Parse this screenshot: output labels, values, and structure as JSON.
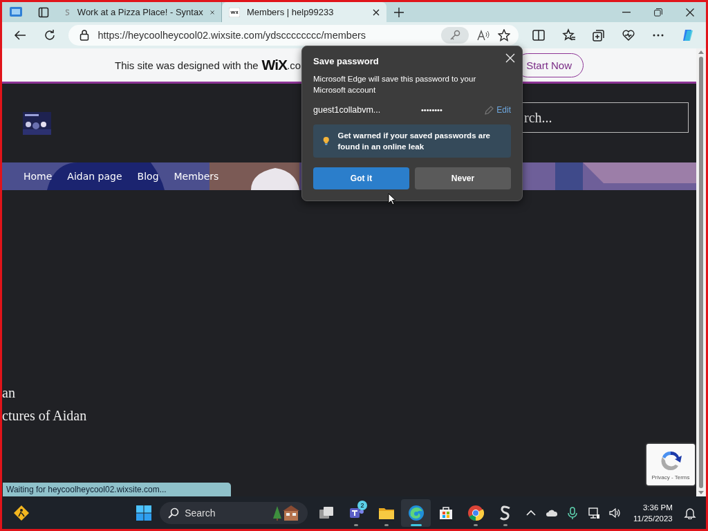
{
  "browser": {
    "tabs": [
      {
        "title": "Work at a Pizza Place! - Syntax",
        "kind": "syntax",
        "selected": false
      },
      {
        "title": "Members | help99233",
        "kind": "wix",
        "selected": true
      }
    ],
    "address": "https://heycoolheycool02.wixsite.com/ydscccccccc/members"
  },
  "banner": {
    "text": "This site was designed with the",
    "logo": "WiX",
    "suffix": ".co",
    "button": "Start Now"
  },
  "site": {
    "search": {
      "placeholder": "rch..."
    },
    "nav": [
      {
        "label": "Home"
      },
      {
        "label": "Aidan page"
      },
      {
        "label": "Blog"
      },
      {
        "label": "Members"
      }
    ],
    "body_lines": [
      "an",
      "ctures of Aidan"
    ]
  },
  "status_bar": "Waiting for heycoolheycool02.wixsite.com...",
  "recaptcha": "Privacy - Terms",
  "popup": {
    "title": "Save password",
    "message": "Microsoft Edge will save this password to your Microsoft account",
    "username": "guest1collabvm...",
    "password": "••••••••",
    "edit": "Edit",
    "tip": "Get warned if your saved passwords are found in an online leak",
    "buttons": [
      {
        "label": "Got it",
        "kind": "primary"
      },
      {
        "label": "Never",
        "kind": "secondary"
      }
    ]
  },
  "taskbar": {
    "search": "Search",
    "apps": [
      {
        "kind": "taskview",
        "running": false,
        "active": false
      },
      {
        "kind": "teams",
        "badge": "2",
        "running": true,
        "active": false
      },
      {
        "kind": "explorer",
        "running": true,
        "active": false
      },
      {
        "kind": "edge",
        "running": true,
        "active": true
      },
      {
        "kind": "store",
        "running": false,
        "active": false
      },
      {
        "kind": "chrome",
        "running": true,
        "active": false
      },
      {
        "kind": "syntax",
        "running": true,
        "active": false
      }
    ],
    "time": "3:36 PM",
    "date": "11/25/2023"
  }
}
